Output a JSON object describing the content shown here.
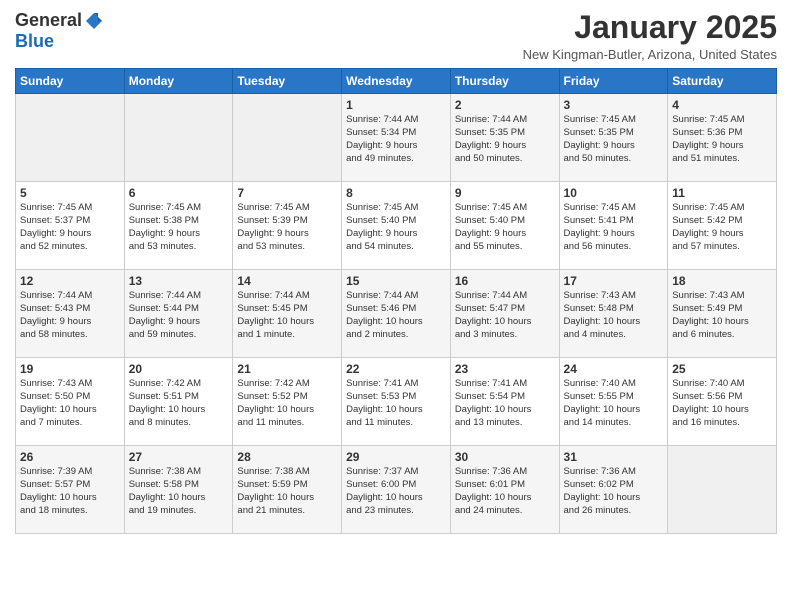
{
  "header": {
    "logo_general": "General",
    "logo_blue": "Blue",
    "title": "January 2025",
    "subtitle": "New Kingman-Butler, Arizona, United States"
  },
  "days_of_week": [
    "Sunday",
    "Monday",
    "Tuesday",
    "Wednesday",
    "Thursday",
    "Friday",
    "Saturday"
  ],
  "weeks": [
    [
      {
        "day": "",
        "info": ""
      },
      {
        "day": "",
        "info": ""
      },
      {
        "day": "",
        "info": ""
      },
      {
        "day": "1",
        "info": "Sunrise: 7:44 AM\nSunset: 5:34 PM\nDaylight: 9 hours\nand 49 minutes."
      },
      {
        "day": "2",
        "info": "Sunrise: 7:44 AM\nSunset: 5:35 PM\nDaylight: 9 hours\nand 50 minutes."
      },
      {
        "day": "3",
        "info": "Sunrise: 7:45 AM\nSunset: 5:35 PM\nDaylight: 9 hours\nand 50 minutes."
      },
      {
        "day": "4",
        "info": "Sunrise: 7:45 AM\nSunset: 5:36 PM\nDaylight: 9 hours\nand 51 minutes."
      }
    ],
    [
      {
        "day": "5",
        "info": "Sunrise: 7:45 AM\nSunset: 5:37 PM\nDaylight: 9 hours\nand 52 minutes."
      },
      {
        "day": "6",
        "info": "Sunrise: 7:45 AM\nSunset: 5:38 PM\nDaylight: 9 hours\nand 53 minutes."
      },
      {
        "day": "7",
        "info": "Sunrise: 7:45 AM\nSunset: 5:39 PM\nDaylight: 9 hours\nand 53 minutes."
      },
      {
        "day": "8",
        "info": "Sunrise: 7:45 AM\nSunset: 5:40 PM\nDaylight: 9 hours\nand 54 minutes."
      },
      {
        "day": "9",
        "info": "Sunrise: 7:45 AM\nSunset: 5:40 PM\nDaylight: 9 hours\nand 55 minutes."
      },
      {
        "day": "10",
        "info": "Sunrise: 7:45 AM\nSunset: 5:41 PM\nDaylight: 9 hours\nand 56 minutes."
      },
      {
        "day": "11",
        "info": "Sunrise: 7:45 AM\nSunset: 5:42 PM\nDaylight: 9 hours\nand 57 minutes."
      }
    ],
    [
      {
        "day": "12",
        "info": "Sunrise: 7:44 AM\nSunset: 5:43 PM\nDaylight: 9 hours\nand 58 minutes."
      },
      {
        "day": "13",
        "info": "Sunrise: 7:44 AM\nSunset: 5:44 PM\nDaylight: 9 hours\nand 59 minutes."
      },
      {
        "day": "14",
        "info": "Sunrise: 7:44 AM\nSunset: 5:45 PM\nDaylight: 10 hours\nand 1 minute."
      },
      {
        "day": "15",
        "info": "Sunrise: 7:44 AM\nSunset: 5:46 PM\nDaylight: 10 hours\nand 2 minutes."
      },
      {
        "day": "16",
        "info": "Sunrise: 7:44 AM\nSunset: 5:47 PM\nDaylight: 10 hours\nand 3 minutes."
      },
      {
        "day": "17",
        "info": "Sunrise: 7:43 AM\nSunset: 5:48 PM\nDaylight: 10 hours\nand 4 minutes."
      },
      {
        "day": "18",
        "info": "Sunrise: 7:43 AM\nSunset: 5:49 PM\nDaylight: 10 hours\nand 6 minutes."
      }
    ],
    [
      {
        "day": "19",
        "info": "Sunrise: 7:43 AM\nSunset: 5:50 PM\nDaylight: 10 hours\nand 7 minutes."
      },
      {
        "day": "20",
        "info": "Sunrise: 7:42 AM\nSunset: 5:51 PM\nDaylight: 10 hours\nand 8 minutes."
      },
      {
        "day": "21",
        "info": "Sunrise: 7:42 AM\nSunset: 5:52 PM\nDaylight: 10 hours\nand 11 minutes."
      },
      {
        "day": "22",
        "info": "Sunrise: 7:41 AM\nSunset: 5:53 PM\nDaylight: 10 hours\nand 11 minutes."
      },
      {
        "day": "23",
        "info": "Sunrise: 7:41 AM\nSunset: 5:54 PM\nDaylight: 10 hours\nand 13 minutes."
      },
      {
        "day": "24",
        "info": "Sunrise: 7:40 AM\nSunset: 5:55 PM\nDaylight: 10 hours\nand 14 minutes."
      },
      {
        "day": "25",
        "info": "Sunrise: 7:40 AM\nSunset: 5:56 PM\nDaylight: 10 hours\nand 16 minutes."
      }
    ],
    [
      {
        "day": "26",
        "info": "Sunrise: 7:39 AM\nSunset: 5:57 PM\nDaylight: 10 hours\nand 18 minutes."
      },
      {
        "day": "27",
        "info": "Sunrise: 7:38 AM\nSunset: 5:58 PM\nDaylight: 10 hours\nand 19 minutes."
      },
      {
        "day": "28",
        "info": "Sunrise: 7:38 AM\nSunset: 5:59 PM\nDaylight: 10 hours\nand 21 minutes."
      },
      {
        "day": "29",
        "info": "Sunrise: 7:37 AM\nSunset: 6:00 PM\nDaylight: 10 hours\nand 23 minutes."
      },
      {
        "day": "30",
        "info": "Sunrise: 7:36 AM\nSunset: 6:01 PM\nDaylight: 10 hours\nand 24 minutes."
      },
      {
        "day": "31",
        "info": "Sunrise: 7:36 AM\nSunset: 6:02 PM\nDaylight: 10 hours\nand 26 minutes."
      },
      {
        "day": "",
        "info": ""
      }
    ]
  ]
}
